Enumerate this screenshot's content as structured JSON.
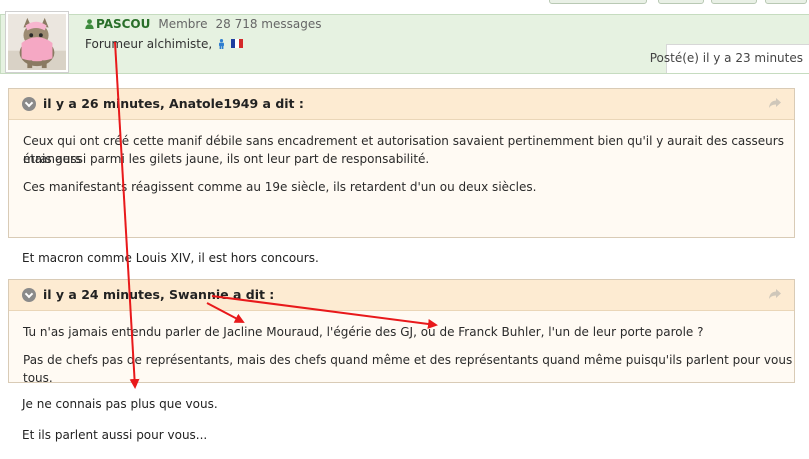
{
  "post": {
    "author_name": "PASCOU",
    "author_role": "Membre",
    "message_count": "28 718 messages",
    "rank": "Forumeur alchimiste,",
    "posted": "Posté(e) il y a 23 minutes"
  },
  "quotes": [
    {
      "title": "il y a 26 minutes, Anatole1949 a dit :",
      "paragraphs": [
        "Ceux qui ont créé cette manif débile sans encadrement et autorisation savaient pertinemment bien qu'il y aurait des casseurs étrangers",
        "mais aussi parmi les gilets jaune, ils ont leur part de responsabilité.",
        "Ces manifestants réagissent comme au 19e siècle, ils retardent d'un ou deux siècles."
      ]
    },
    {
      "title": "il y a 24 minutes, Swannie a dit :",
      "paragraphs": [
        "Tu n'as jamais entendu parler de Jacline Mouraud, l'égérie des GJ, ou de Franck Buhler, l'un de leur porte parole ?",
        "Pas de chefs pas de représentants, mais des chefs quand même et des représentants quand même puisqu'ils parlent pour vous tous."
      ]
    }
  ],
  "replies": [
    "Et macron comme Louis XIV, il est hors concours.",
    "Je ne connais pas plus que vous.",
    "Et ils parlent aussi pour vous..."
  ],
  "colors": {
    "header_bg": "#e6f2e1",
    "quote_head_bg": "#fdebd2",
    "quote_body_bg": "#fffaf3",
    "annotation_arrow": "#e8191b"
  },
  "icons": [
    "user-icon",
    "male-icon",
    "french-flag-icon",
    "collapse-chevron-icon",
    "share-icon",
    "cat-avatar"
  ]
}
